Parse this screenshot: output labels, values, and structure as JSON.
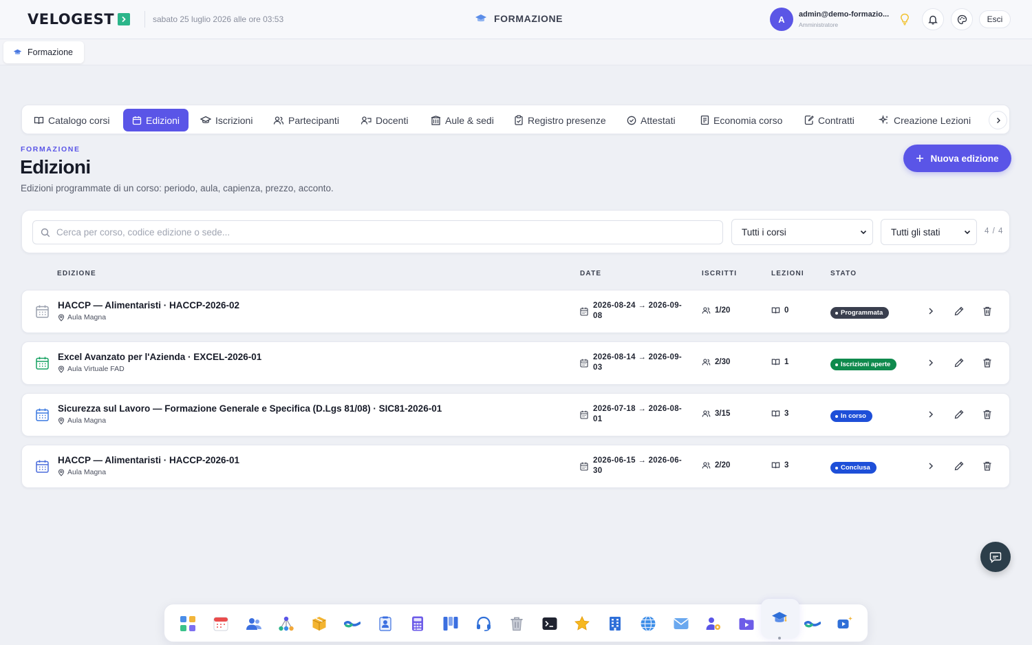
{
  "app": {
    "logo": "VELOGEST",
    "datetime": "sabato 25 luglio 2026 alle ore 03:53",
    "module_title": "FORMAZIONE",
    "user_email": "admin@demo-formazio...",
    "user_role": "Amministratore",
    "user_initial": "A",
    "logout_label": "Esci"
  },
  "breadcrumb": {
    "tab_label": "Formazione"
  },
  "tabs": [
    {
      "label": "Catalogo corsi",
      "icon": "book-open-icon"
    },
    {
      "label": "Edizioni",
      "icon": "calendar-icon",
      "active": true
    },
    {
      "label": "Iscrizioni",
      "icon": "graduation-cap-icon"
    },
    {
      "label": "Partecipanti",
      "icon": "users-icon"
    },
    {
      "label": "Docenti",
      "icon": "teacher-icon"
    },
    {
      "label": "Aule & sedi",
      "icon": "building-icon"
    },
    {
      "label": "Registro presenze",
      "icon": "clipboard-check-icon"
    },
    {
      "label": "Attestati",
      "icon": "check-circle-icon"
    },
    {
      "label": "Economia corso",
      "icon": "receipt-icon"
    },
    {
      "label": "Contratti",
      "icon": "file-signature-icon"
    },
    {
      "label": "Creazione Lezioni",
      "icon": "sparkles-icon"
    }
  ],
  "header": {
    "eyebrow": "FORMAZIONE",
    "title": "Edizioni",
    "subtitle": "Edizioni programmate di un corso: periodo, aula, capienza, prezzo, acconto.",
    "new_button": "Nuova edizione"
  },
  "filters": {
    "search_placeholder": "Cerca per corso, codice edizione o sede...",
    "course_select": "Tutti i corsi",
    "status_select": "Tutti gli stati",
    "count": "4 / 4"
  },
  "table": {
    "columns": [
      "EDIZIONE",
      "DATE",
      "ISCRITTI",
      "LEZIONI",
      "STATO"
    ],
    "rows": [
      {
        "title": "HACCP — Alimentaristi · HACCP-2026-02",
        "location": "Aula Magna",
        "dates_line1": "2026-08-24 → 2026-09-",
        "dates_line2": "08",
        "enrolled": "1/20",
        "lessons": "0",
        "status": "Programmata",
        "status_color": "#3a3f4e",
        "icon_color": "#9aa0ae"
      },
      {
        "title": "Excel Avanzato per l'Azienda · EXCEL-2026-01",
        "location": "Aula Virtuale FAD",
        "dates_line1": "2026-08-14 → 2026-09-",
        "dates_line2": "03",
        "enrolled": "2/30",
        "lessons": "1",
        "status": "Iscrizioni aperte",
        "status_color": "#0f8a4d",
        "icon_color": "#17a262"
      },
      {
        "title": "Sicurezza sul Lavoro — Formazione Generale e Specifica (D.Lgs 81/08) · SIC81-2026-01",
        "location": "Aula Magna",
        "dates_line1": "2026-07-18 → 2026-08-",
        "dates_line2": "01",
        "enrolled": "3/15",
        "lessons": "3",
        "status": "In corso",
        "status_color": "#1e4fd8",
        "icon_color": "#3a78e0"
      },
      {
        "title": "HACCP — Alimentaristi · HACCP-2026-01",
        "location": "Aula Magna",
        "dates_line1": "2026-06-15 → 2026-06-",
        "dates_line2": "30",
        "enrolled": "2/20",
        "lessons": "3",
        "status": "Conclusa",
        "status_color": "#1e4fd8",
        "icon_color": "#4a6cdc"
      }
    ]
  },
  "dock": [
    "apps-grid-icon",
    "calendar-app-icon",
    "contacts-icon",
    "network-icon",
    "package-icon",
    "handshake-icon",
    "id-badge-icon",
    "calculator-icon",
    "kanban-icon",
    "headset-icon",
    "trash-icon",
    "terminal-icon",
    "star-icon",
    "office-building-icon",
    "globe-icon",
    "mail-icon",
    "user-settings-icon",
    "video-folder-icon",
    "graduation-cap-icon",
    "handshake-icon",
    "video-sparkle-icon"
  ]
}
